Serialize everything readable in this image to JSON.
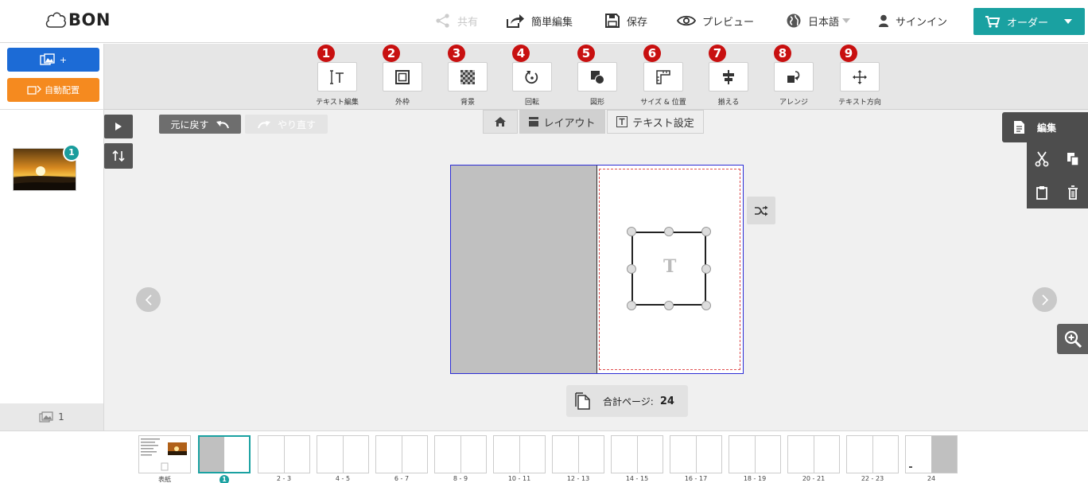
{
  "header": {
    "logo": "BON",
    "share_label": "共有",
    "quick_edit_label": "簡単編集",
    "save_label": "保存",
    "preview_label": "プレビュー",
    "language_label": "日本語",
    "signin_label": "サインイン",
    "order_label": "オーダー"
  },
  "toolbar": {
    "tools": [
      {
        "num": "1",
        "label": "テキスト編集",
        "icon": "text-cursor-icon"
      },
      {
        "num": "2",
        "label": "外枠",
        "icon": "frame-icon"
      },
      {
        "num": "3",
        "label": "背景",
        "icon": "checker-icon"
      },
      {
        "num": "4",
        "label": "回転",
        "icon": "rotate-icon"
      },
      {
        "num": "5",
        "label": "図形",
        "icon": "shape-icon"
      },
      {
        "num": "6",
        "label": "サイズ & 位置",
        "icon": "ruler-icon"
      },
      {
        "num": "7",
        "label": "揃える",
        "icon": "align-icon"
      },
      {
        "num": "8",
        "label": "アレンジ",
        "icon": "arrange-icon"
      },
      {
        "num": "9",
        "label": "テキスト方向",
        "icon": "move-icon"
      }
    ]
  },
  "left_panel": {
    "add_photos_label": "+",
    "auto_layout_label": "自動配置",
    "thumb_badge": "1",
    "photo_count": "1"
  },
  "canvas": {
    "undo_label": "元に戻す",
    "redo_label": "やり直す",
    "tab_layout": "レイアウト",
    "tab_text": "テキスト設定",
    "edit_panel_label": "編集",
    "text_placeholder": "T",
    "page_count_label": "合計ページ:",
    "page_count_value": "24"
  },
  "filmstrip": {
    "pages": [
      "表紙",
      "1",
      "2 - 3",
      "4 - 5",
      "6 - 7",
      "8 - 9",
      "10 - 11",
      "12 - 13",
      "14 - 15",
      "16 - 17",
      "18 - 19",
      "20 - 21",
      "22 - 23",
      "24"
    ]
  },
  "colors": {
    "accent": "#1aa1a1",
    "blue": "#1c6bd6",
    "orange": "#f58a1f",
    "badge_red": "#c81010"
  }
}
